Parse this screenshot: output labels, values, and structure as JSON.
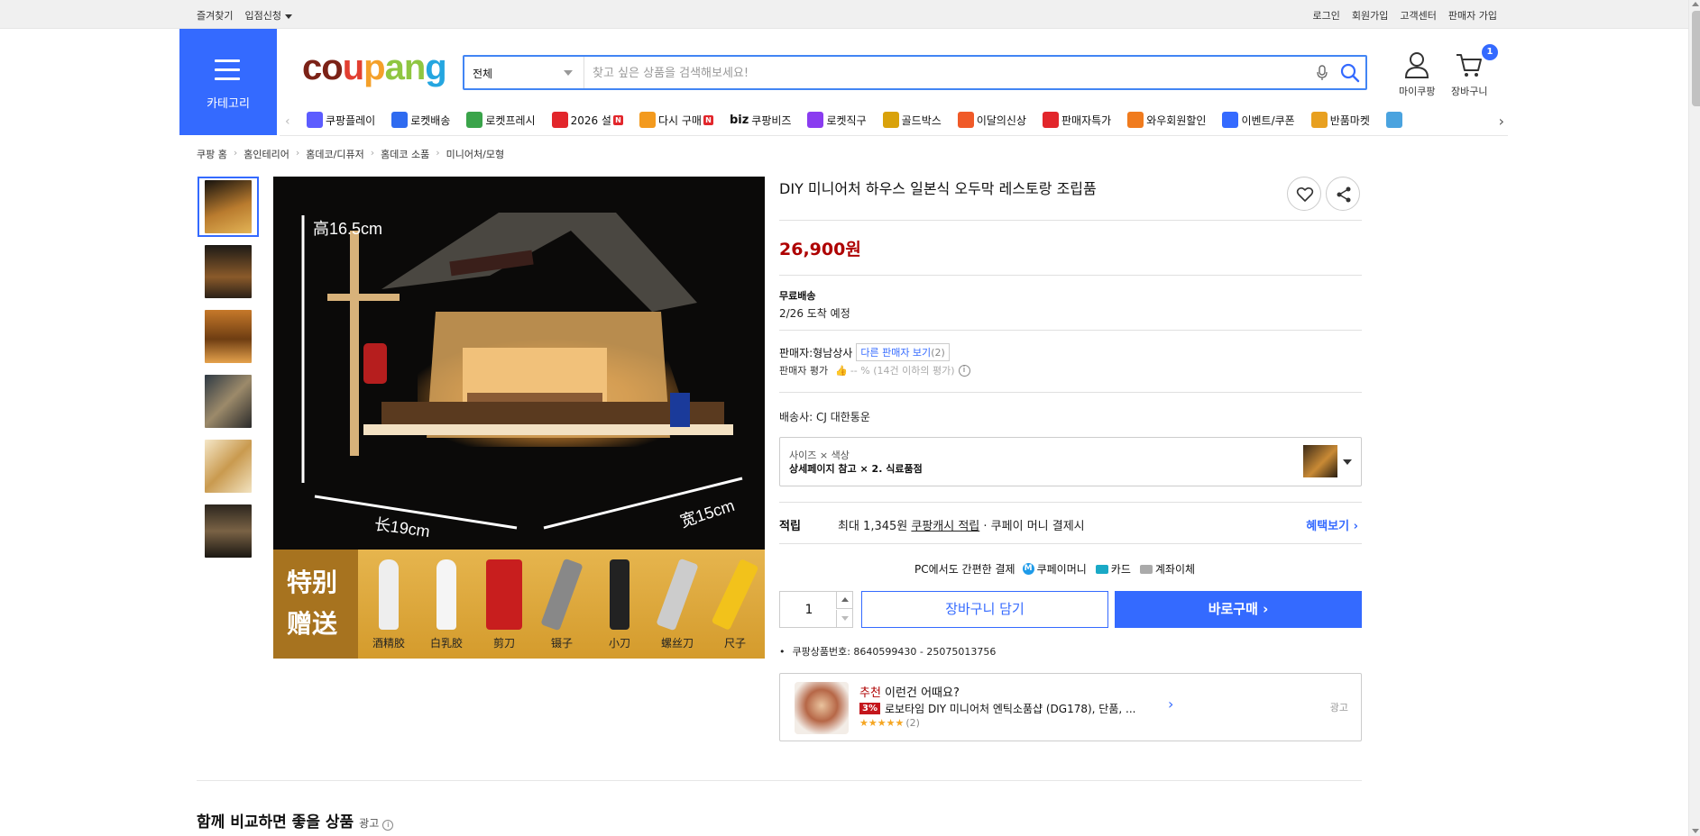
{
  "util": {
    "left": [
      "즐겨찾기",
      "입점신청"
    ],
    "right": [
      "로그인",
      "회원가입",
      "고객센터",
      "판매자 가입"
    ]
  },
  "header": {
    "category_label": "카테고리",
    "logo": [
      "c",
      "o",
      "u",
      "p",
      "a",
      "n",
      "g"
    ],
    "search_category": "전체",
    "search_placeholder": "찾고 싶은 상품을 검색해보세요!",
    "mycoupang": "마이쿠팡",
    "cart": "장바구니",
    "cart_count": "1"
  },
  "nav": {
    "items": [
      {
        "label": "쿠팡플레이",
        "icon": "play-icon",
        "color": "#5c5cff"
      },
      {
        "label": "로켓배송",
        "icon": "rocket-icon",
        "color": "#2f6bf0"
      },
      {
        "label": "로켓프레시",
        "icon": "rocket-fresh-icon",
        "color": "#3aa44a"
      },
      {
        "label": "2026 설",
        "icon": "hanbok-icon",
        "color": "#e2262b",
        "badge": "N"
      },
      {
        "label": "다시 구매",
        "icon": "repurchase-icon",
        "color": "#f39a1e",
        "badge": "N"
      },
      {
        "label": "쿠팡비즈",
        "icon": "biz-icon",
        "color": "#222",
        "prefix": "biz"
      },
      {
        "label": "로켓직구",
        "icon": "global-rocket-icon",
        "color": "#8a3cf0"
      },
      {
        "label": "골드박스",
        "icon": "goldbox-icon",
        "color": "#d9a20b"
      },
      {
        "label": "이달의신상",
        "icon": "new-bag-icon",
        "color": "#f05a28"
      },
      {
        "label": "판매자특가",
        "icon": "percent-icon",
        "color": "#e2262b"
      },
      {
        "label": "와우회원할인",
        "icon": "wow-icon",
        "color": "#f07b1e"
      },
      {
        "label": "이벤트/쿠폰",
        "icon": "coupon-icon",
        "color": "#346aff"
      },
      {
        "label": "반품마켓",
        "icon": "market-icon",
        "color": "#e8a020"
      },
      {
        "label": "",
        "icon": "more-icon",
        "color": "#4aa3df"
      }
    ]
  },
  "breadcrumb": [
    "쿠팡 홈",
    "홈인테리어",
    "홈데코/디퓨저",
    "홈데코 소품",
    "미니어처/모형"
  ],
  "gallery": {
    "main_labels": {
      "height": "高16.5cm",
      "length": "长19cm",
      "width": "宽15cm",
      "special": "特别",
      "gift": "赠送"
    },
    "tools": [
      "酒精胶",
      "白乳胶",
      "剪刀",
      "镊子",
      "小刀",
      "螺丝刀",
      "尺子"
    ]
  },
  "product": {
    "title": "DIY 미니어처 하우스 일본식 오두막 레스토랑 조립품",
    "price": "26,900원",
    "shipping_label": "무료배송",
    "delivery": "2/26 도착 예정",
    "seller_prefix": "판매자:",
    "seller_name": "형남상사",
    "other_sellers": "다른 판매자 보기",
    "other_sellers_count": "(2)",
    "seller_rating_label": "판매자 평가",
    "seller_rating_value": "-- % (14건 이하의 평가)",
    "carrier": "배송사:  CJ 대한통운",
    "option_label": "사이즈 × 색상",
    "option_value": "상세페이지 참고 × 2. 식료품점",
    "reward_label": "적립",
    "reward_text_1": "최대 1,345원",
    "reward_text_link": "쿠팡캐시 적립",
    "reward_text_2": "· 쿠페이 머니 결제시",
    "reward_link": "혜택보기 ›",
    "pay_title": "PC에서도 간편한 결제",
    "pay_coupay": "쿠페이머니",
    "pay_card": "카드",
    "pay_bank": "계좌이체",
    "quantity": "1",
    "add_to_cart": "장바구니 담기",
    "buy_now": "바로구매 ›",
    "product_number": "쿠팡상품번호: 8640599430 - 25075013756"
  },
  "recommend": {
    "tag": "추천",
    "heading": " 이런건 어때요?",
    "discount": "3%",
    "name": "로보타임 DIY 미니어처 엔틱소품샵 (DG178), 단품, ...",
    "stars": "★★★★★",
    "reviews": "(2)",
    "ad": "광고"
  },
  "section": {
    "title": "함께 비교하면 좋을 상품",
    "ad": "광고"
  },
  "colors": {
    "accent": "#346aff",
    "price": "#ae0000"
  }
}
